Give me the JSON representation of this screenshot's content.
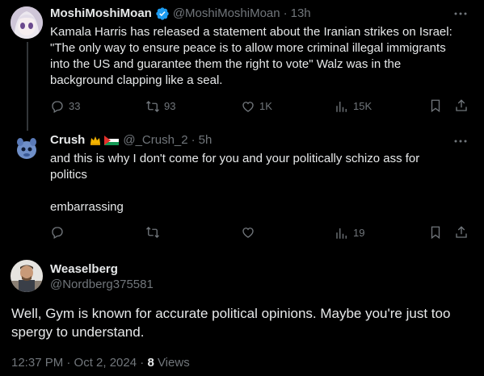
{
  "tweets": [
    {
      "name": "MoshiMoshiMoan",
      "handle": "@MoshiMoshiMoan",
      "time": "13h",
      "text_lines": [
        "Kamala Harris has released a statement about the Iranian strikes on Israel:",
        "\"The only way to ensure peace is to allow more criminal illegal immigrants",
        "into the US and guarantee them the right to vote\"  Walz was in the",
        "background clapping like a seal."
      ],
      "replies": "33",
      "reposts": "93",
      "likes": "1K",
      "views": "15K"
    },
    {
      "name": "Crush",
      "handle": "@_Crush_2",
      "time": "5h",
      "text_lines": [
        "and this is why I don't come for you and your politically schizo ass for",
        "politics",
        "",
        "embarrassing"
      ],
      "views": "19"
    }
  ],
  "main_tweet": {
    "name": "Weaselberg",
    "handle": "@Nordberg375581",
    "text_lines": [
      "Well, Gym is known for accurate political opinions. Maybe you're just too",
      "spergy to understand."
    ],
    "timestamp": "12:37 PM · Oct 2, 2024",
    "sep": "·",
    "views_count": "8",
    "views_label": "Views"
  },
  "separator": "·",
  "colors": {
    "background": "#000000",
    "text": "#e7e9ea",
    "muted": "#71767b",
    "verified": "#1d9bf0",
    "divider": "#2f3336"
  },
  "icons": [
    "more-icon",
    "reply-icon",
    "repost-icon",
    "like-icon",
    "views-icon",
    "bookmark-icon",
    "share-icon",
    "verified-icon",
    "crown-icon",
    "palestine-flag-icon"
  ]
}
